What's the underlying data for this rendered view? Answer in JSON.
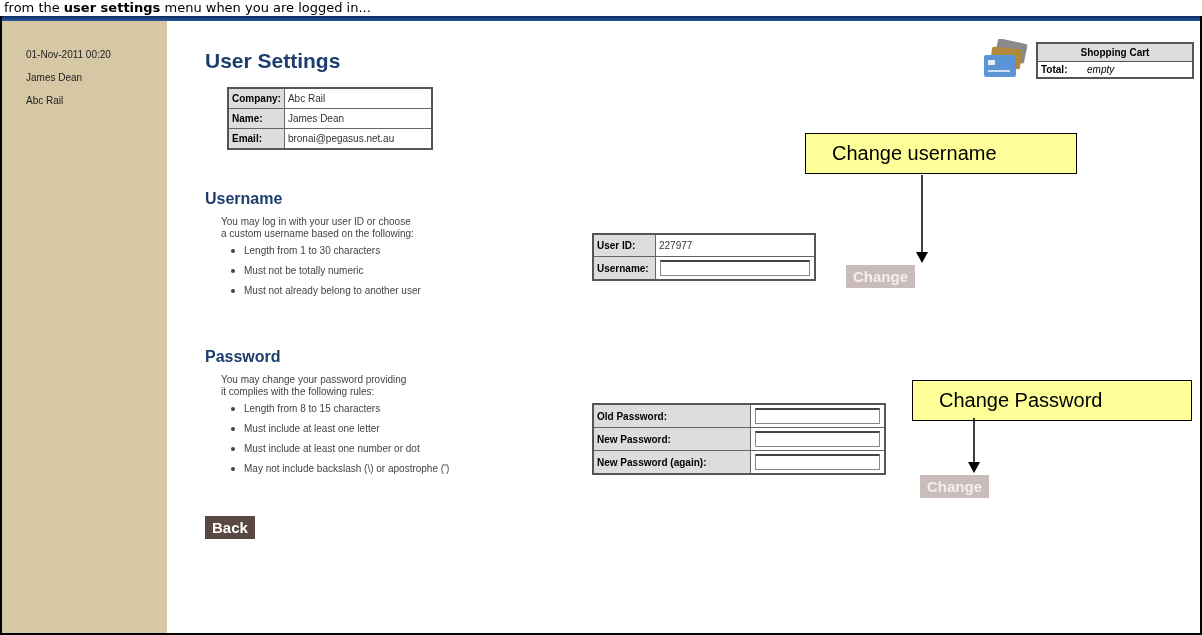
{
  "caption": "from the **user settings** menu when you are logged in...",
  "sidebar": {
    "items": [
      "01-Nov-2011 00:20",
      "James Dean",
      "Abc Rail"
    ]
  },
  "page_title": "User Settings",
  "cart": {
    "title": "Shopping Cart",
    "total_label": "Total:",
    "total_value": "empty"
  },
  "details": [
    {
      "label": "Company:",
      "value": "Abc Rail"
    },
    {
      "label": "Name:",
      "value": "James Dean"
    },
    {
      "label": "Email:",
      "value": "bronai@pegasus.net.au"
    }
  ],
  "sections": [
    {
      "heading": "Username",
      "intro_lines": [
        "You may log in with your user ID or choose",
        "a custom username based on the following:"
      ],
      "rules": [
        "Length from 1 to 30 characters",
        "Must not be totally numeric",
        "Must not already belong to another user"
      ],
      "form": [
        {
          "label": "User ID:",
          "kind": "text",
          "value": "227977"
        },
        {
          "label": "Username:",
          "kind": "input"
        }
      ],
      "button": {
        "label": "Change",
        "disabled": true
      },
      "callout": "Change username"
    },
    {
      "heading": "Password",
      "intro_lines": [
        "You may change your password providing",
        "it complies with the following rules:"
      ],
      "rules": [
        "Length from 8 to 15 characters",
        "Must include at least one letter",
        "Must include at least one number or dot",
        "May not include backslash (\\) or apostrophe (')"
      ],
      "form": [
        {
          "label": "Old Password:",
          "kind": "input"
        },
        {
          "label": "New Password:",
          "kind": "input"
        },
        {
          "label": "New Password (again):",
          "kind": "input"
        }
      ],
      "button": {
        "label": "Change",
        "disabled": true
      },
      "callout": "Change Password"
    }
  ],
  "back_button": "Back"
}
